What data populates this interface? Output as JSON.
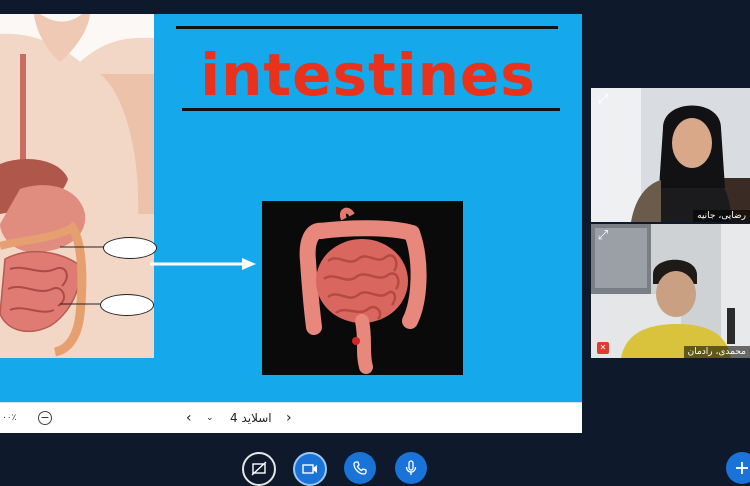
{
  "slide": {
    "title": "intestines"
  },
  "toolbar": {
    "zoom_value": "۰۰٪",
    "zoom_out": "−",
    "prev": "‹",
    "dropdown": "⌄",
    "slide_label": "اسلاید 4",
    "next": "›"
  },
  "participants": [
    {
      "name": "رضایی، جانیه",
      "expand_icon": "expand-icon"
    },
    {
      "name": "محمدی، رادمان",
      "expand_icon": "expand-icon",
      "mic": "muted"
    }
  ],
  "colors": {
    "slide_bg": "#15a8ea",
    "title_color": "#e8321c",
    "accent_blue": "#1a73d8",
    "app_bg": "#0e1a2b"
  },
  "controls": [
    "screen-share-off-icon",
    "video-camera-icon",
    "phone-call-icon",
    "microphone-icon",
    "plus-icon"
  ]
}
